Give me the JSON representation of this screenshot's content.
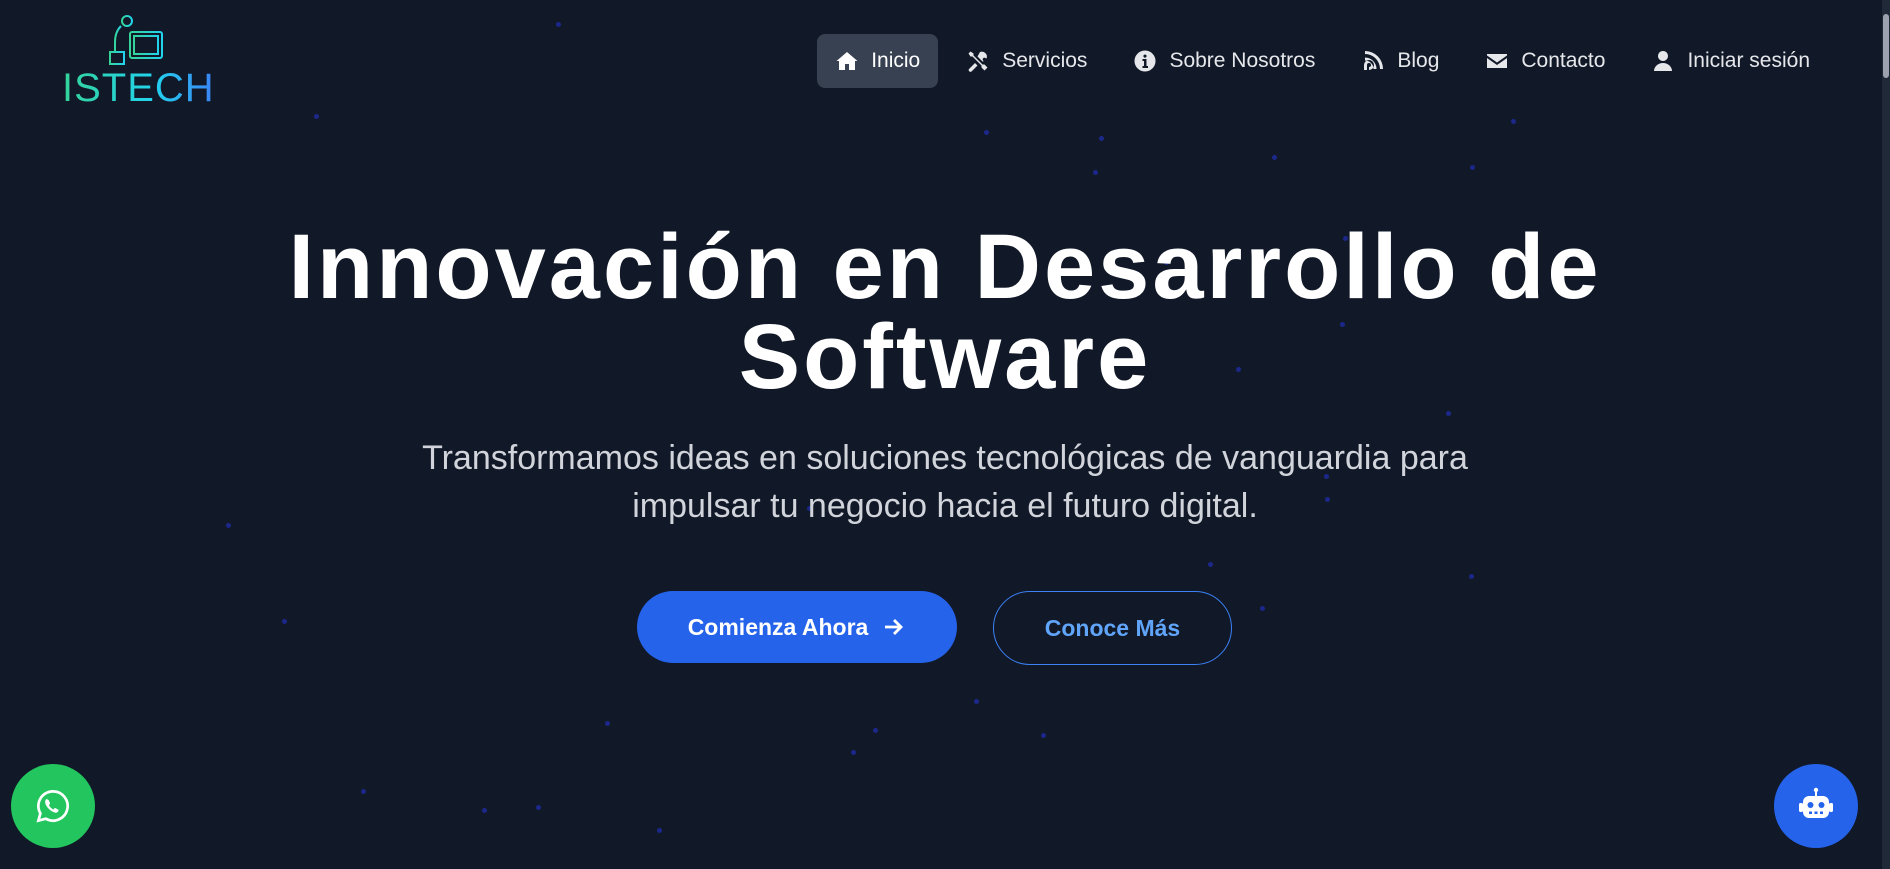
{
  "brand": {
    "logo_text": "ISTECH"
  },
  "nav": {
    "items": [
      {
        "label": "Inicio",
        "icon": "home-icon",
        "active": true
      },
      {
        "label": "Servicios",
        "icon": "tools-icon",
        "active": false
      },
      {
        "label": "Sobre Nosotros",
        "icon": "info-circle-icon",
        "active": false
      },
      {
        "label": "Blog",
        "icon": "rss-icon",
        "active": false
      },
      {
        "label": "Contacto",
        "icon": "envelope-icon",
        "active": false
      },
      {
        "label": "Iniciar sesión",
        "icon": "user-icon",
        "active": false
      }
    ]
  },
  "hero": {
    "title_line1": "Innovación en Desarrollo de",
    "title_line2": "Software",
    "subtitle_line1": "Transformamos ideas en soluciones tecnológicas de vanguardia para",
    "subtitle_line2": "impulsar tu negocio hacia el futuro digital.",
    "primary_button": "Comienza Ahora",
    "secondary_button": "Conoce Más"
  },
  "floating": {
    "whatsapp_icon": "whatsapp-icon",
    "bot_icon": "robot-icon"
  },
  "colors": {
    "background": "#111827",
    "accent": "#2563eb",
    "accent_light": "#60a5fa",
    "nav_active_bg": "#374151",
    "whatsapp": "#22c55e",
    "logo_gradient_start": "#34d399",
    "logo_gradient_end": "#3b82f6"
  }
}
